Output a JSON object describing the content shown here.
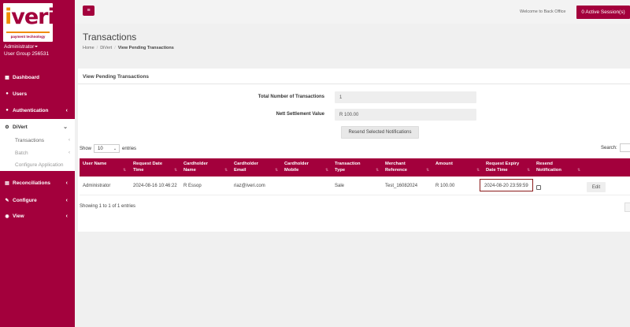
{
  "brand": {
    "logo_text_i": "i",
    "logo_text_rest": "veri",
    "logo_tagline": "payment technology",
    "role": "Administrator",
    "user_group": "User Group 256531",
    "accent_color": "#a3003c"
  },
  "sidebar": {
    "items": [
      {
        "label": "Dashboard",
        "icon": "grid-icon"
      },
      {
        "label": "Users",
        "icon": "user-icon"
      },
      {
        "label": "Authentication",
        "icon": "dot-icon"
      },
      {
        "label": "DiVert",
        "icon": "gear-icon"
      },
      {
        "label": "Reconciliations",
        "icon": "table-icon"
      },
      {
        "label": "Configure",
        "icon": "wrench-icon"
      },
      {
        "label": "View",
        "icon": "eye-icon"
      }
    ],
    "submenu": [
      {
        "label": "Transactions"
      },
      {
        "label": "Batch"
      },
      {
        "label": "Configure Application"
      }
    ]
  },
  "topbar": {
    "welcome": "Welcome to Back Office",
    "sessions": "0 Active Session(s)"
  },
  "page": {
    "title": "Transactions",
    "breadcrumb": [
      "Home",
      "DiVert",
      "View Pending Transactions"
    ]
  },
  "panel": {
    "title": "View Pending Transactions",
    "total_label": "Total Number of Transactions",
    "total_value": "1",
    "nett_label": "Nett Settlement Value",
    "nett_value": "R 100.00",
    "resend_button": "Resend Selected Notifications",
    "show_label": "Show",
    "entries_value": "10",
    "entries_label": "entries",
    "search_label": "Search:"
  },
  "table": {
    "columns": [
      {
        "line1": "User Name",
        "line2": ""
      },
      {
        "line1": "Request Date",
        "line2": "Time"
      },
      {
        "line1": "Cardholder",
        "line2": "Name"
      },
      {
        "line1": "Cardholder",
        "line2": "Email"
      },
      {
        "line1": "Cardholder",
        "line2": "Mobile"
      },
      {
        "line1": "Transaction",
        "line2": "Type"
      },
      {
        "line1": "Merchant",
        "line2": "Reference"
      },
      {
        "line1": "Amount",
        "line2": ""
      },
      {
        "line1": "Request Expiry",
        "line2": "Date Time"
      },
      {
        "line1": "Resend",
        "line2": "Notification"
      }
    ],
    "rows": [
      {
        "user": "Administrator",
        "request_date": "2024-08-16 10:46:22",
        "name": "R Essop",
        "email": "riaz@iveri.com",
        "mobile": "",
        "type": "Sale",
        "reference": "Test_16082024",
        "amount": "R 100.00",
        "expiry": "2024-08-20 23:59:59",
        "edit": "Edit"
      }
    ],
    "showing": "Showing 1 to 1 of 1 entries"
  }
}
